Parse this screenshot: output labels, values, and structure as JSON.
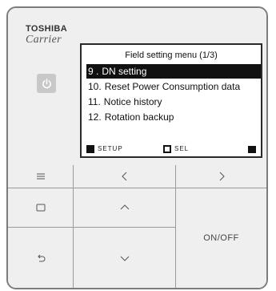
{
  "brand": {
    "maker": "TOSHIBA",
    "sub": "Carrier"
  },
  "screen": {
    "title": "Field setting menu (1/3)",
    "items": [
      {
        "number": "9 .",
        "label": "DN setting",
        "selected": true
      },
      {
        "number": "10.",
        "label": "Reset Power Consumption data",
        "selected": false
      },
      {
        "number": "11.",
        "label": "Notice history",
        "selected": false
      },
      {
        "number": "12.",
        "label": "Rotation backup",
        "selected": false
      }
    ],
    "footer": {
      "left_text": "SETUP",
      "middle_text": "SEL"
    }
  },
  "buttons": {
    "on_off_label": "ON/OFF"
  },
  "icons": {
    "power": "power-icon",
    "menu": "menu-icon",
    "left": "chevron-left-icon",
    "right": "chevron-right-icon",
    "square": "square-icon",
    "up": "chevron-up-icon",
    "back": "return-icon",
    "down": "chevron-down-icon"
  }
}
